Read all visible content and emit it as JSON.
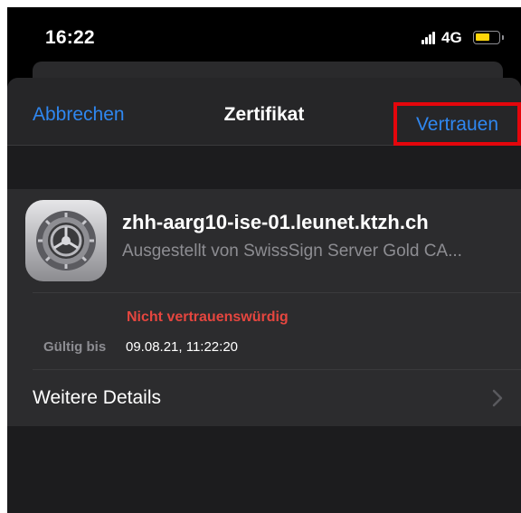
{
  "status_bar": {
    "time": "16:22",
    "network": "4G",
    "battery_color": "#ffd60a"
  },
  "nav": {
    "cancel_label": "Abbrechen",
    "title": "Zertifikat",
    "trust_label": "Vertrauen",
    "accent_color": "#2f87f0",
    "highlight_color": "#e4060c"
  },
  "certificate": {
    "icon": "settings-gear-icon",
    "name": "zhh-aarg10-ise-01.leunet.ktzh.ch",
    "issuer": "Ausgestellt von SwissSign Server Gold CA...",
    "status": "Nicht vertrauenswürdig",
    "status_color": "#e5463f",
    "valid_until_label": "Gültig bis",
    "valid_until_value": "09.08.21, 11:22:20"
  },
  "details": {
    "label": "Weitere Details",
    "icon": "chevron-right-icon"
  }
}
